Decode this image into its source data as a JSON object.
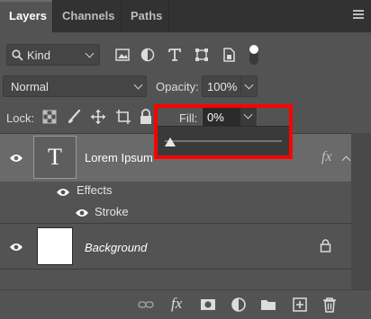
{
  "tabs": [
    {
      "label": "Layers",
      "active": true
    },
    {
      "label": "Channels",
      "active": false
    },
    {
      "label": "Paths",
      "active": false
    }
  ],
  "filter": {
    "kind_label": "Kind",
    "icons": [
      "image-filter-icon",
      "adjustment-filter-icon",
      "type-filter-icon",
      "shape-filter-icon",
      "smart-object-filter-icon",
      "filter-toggle-icon"
    ]
  },
  "blend": {
    "mode": "Normal",
    "opacity_label": "Opacity:",
    "opacity_value": "100%"
  },
  "lock": {
    "label": "Lock:",
    "icons": [
      "lock-transparent-pixels-icon",
      "lock-image-pixels-icon",
      "lock-position-icon",
      "lock-artboard-icon",
      "lock-all-icon"
    ]
  },
  "fill": {
    "label": "Fill:",
    "value": "0%",
    "slider_fraction": 0.0
  },
  "layers": [
    {
      "name": "Lorem Ipsum",
      "type": "text",
      "thumb_glyph": "T",
      "fx": "fx",
      "selected": true
    },
    {
      "name": "Effects",
      "type": "effects-header"
    },
    {
      "name": "Stroke",
      "type": "effect"
    },
    {
      "name": "Background",
      "type": "image",
      "locked": true
    }
  ],
  "bottom_icons": [
    "link-layers-icon",
    "add-layer-style-icon",
    "add-mask-icon",
    "new-adjustment-layer-icon",
    "new-group-icon",
    "new-layer-icon",
    "delete-layer-icon"
  ],
  "bottom_fx_label": "fx",
  "colors": {
    "highlight": "#ff0000",
    "panel": "#535353",
    "tabbar": "#323232"
  }
}
